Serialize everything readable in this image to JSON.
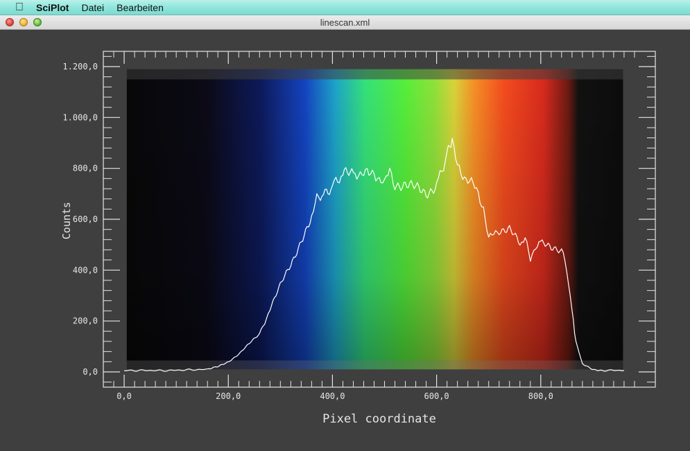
{
  "menubar": {
    "apple_icon": "apple-icon",
    "app_name": "SciPlot",
    "items": [
      "Datei",
      "Bearbeiten"
    ],
    "bg_color": "#8fe6dc"
  },
  "window": {
    "title": "linescan.xml",
    "controls": [
      "close-icon",
      "minimize-icon",
      "zoom-icon"
    ]
  },
  "chart_data": {
    "type": "line",
    "xlabel": "Pixel coordinate",
    "ylabel": "Counts",
    "xlim": [
      -40,
      1020
    ],
    "ylim": [
      -60,
      1260
    ],
    "xticks": [
      0,
      200,
      400,
      600,
      800
    ],
    "xtick_labels": [
      "0,0",
      "200,0",
      "400,0",
      "600,0",
      "800,0"
    ],
    "yticks": [
      0,
      200,
      400,
      600,
      800,
      1000,
      1200
    ],
    "ytick_labels": [
      "0,0",
      "200,0",
      "400,0",
      "600,0",
      "800,0",
      "1.000,0",
      "1.200,0"
    ],
    "line_color": "#ffffff",
    "background_image": "spectrum",
    "series": [
      {
        "x": [
          0,
          40,
          80,
          120,
          160,
          180,
          200,
          220,
          240,
          260,
          270,
          280,
          300,
          320,
          340,
          360,
          370,
          380,
          400,
          410,
          420,
          440,
          450,
          460,
          470,
          480,
          490,
          500,
          510,
          520,
          540,
          560,
          580,
          600,
          610,
          620,
          625,
          630,
          640,
          650,
          660,
          670,
          680,
          690,
          700,
          710,
          720,
          740,
          760,
          770,
          780,
          790,
          800,
          820,
          840,
          850,
          860,
          865,
          870,
          880,
          900,
          920,
          960
        ],
        "y": [
          5,
          6,
          5,
          8,
          10,
          20,
          40,
          70,
          110,
          150,
          190,
          250,
          340,
          420,
          520,
          600,
          680,
          700,
          730,
          760,
          780,
          770,
          790,
          780,
          770,
          790,
          760,
          730,
          800,
          740,
          740,
          720,
          700,
          740,
          780,
          870,
          890,
          900,
          800,
          780,
          760,
          730,
          700,
          650,
          520,
          540,
          560,
          560,
          500,
          520,
          440,
          500,
          510,
          480,
          480,
          400,
          250,
          150,
          100,
          30,
          10,
          6,
          6
        ]
      }
    ]
  }
}
